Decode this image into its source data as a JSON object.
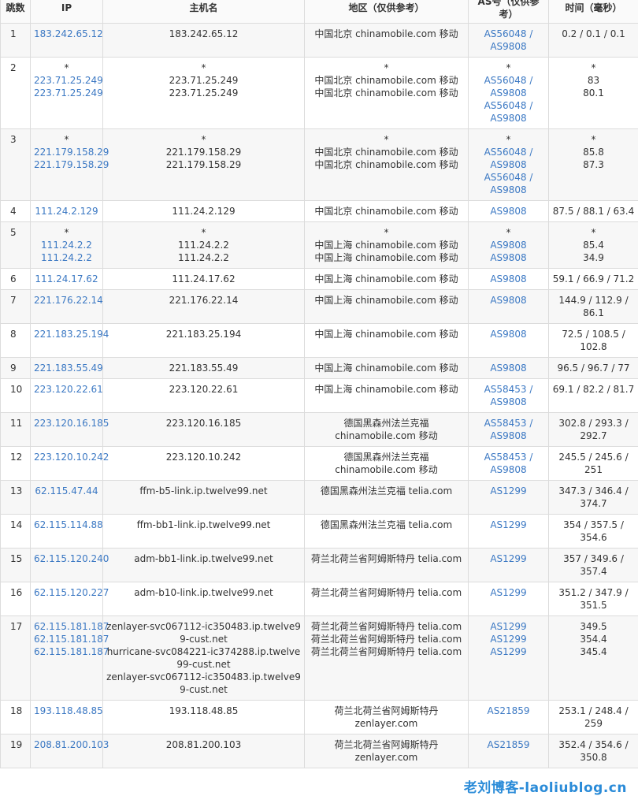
{
  "headers": {
    "hop": "跳数",
    "ip": "IP",
    "host": "主机名",
    "region": "地区（仅供参考）",
    "as": "AS号（仅供参考）",
    "time": "时间（毫秒）"
  },
  "rows": [
    {
      "hop": "1",
      "ip": [
        "183.242.65.12"
      ],
      "host": [
        "183.242.65.12"
      ],
      "region": [
        "中国北京 chinamobile.com 移动"
      ],
      "as": [
        "AS56048 / AS9808"
      ],
      "time": [
        "0.2 / 0.1 / 0.1"
      ]
    },
    {
      "hop": "2",
      "ip": [
        "*",
        "223.71.25.249",
        "223.71.25.249"
      ],
      "host": [
        "*",
        "223.71.25.249",
        "223.71.25.249"
      ],
      "region": [
        "*",
        "中国北京 chinamobile.com 移动",
        "中国北京 chinamobile.com 移动"
      ],
      "as": [
        "*",
        "AS56048 / AS9808",
        "AS56048 / AS9808"
      ],
      "time": [
        "*",
        "83",
        "80.1"
      ]
    },
    {
      "hop": "3",
      "ip": [
        "*",
        "221.179.158.29",
        "221.179.158.29"
      ],
      "host": [
        "*",
        "221.179.158.29",
        "221.179.158.29"
      ],
      "region": [
        "*",
        "中国北京 chinamobile.com 移动",
        "中国北京 chinamobile.com 移动"
      ],
      "as": [
        "*",
        "AS56048 / AS9808",
        "AS56048 / AS9808"
      ],
      "time": [
        "*",
        "85.8",
        "87.3"
      ]
    },
    {
      "hop": "4",
      "ip": [
        "111.24.2.129"
      ],
      "host": [
        "111.24.2.129"
      ],
      "region": [
        "中国北京 chinamobile.com 移动"
      ],
      "as": [
        "AS9808"
      ],
      "time": [
        "87.5 / 88.1 / 63.4"
      ]
    },
    {
      "hop": "5",
      "ip": [
        "*",
        "111.24.2.2",
        "111.24.2.2"
      ],
      "host": [
        "*",
        "111.24.2.2",
        "111.24.2.2"
      ],
      "region": [
        "*",
        "中国上海 chinamobile.com 移动",
        "中国上海 chinamobile.com 移动"
      ],
      "as": [
        "*",
        "AS9808",
        "AS9808"
      ],
      "time": [
        "*",
        "85.4",
        "34.9"
      ]
    },
    {
      "hop": "6",
      "ip": [
        "111.24.17.62"
      ],
      "host": [
        "111.24.17.62"
      ],
      "region": [
        "中国上海 chinamobile.com 移动"
      ],
      "as": [
        "AS9808"
      ],
      "time": [
        "59.1 / 66.9 / 71.2"
      ]
    },
    {
      "hop": "7",
      "ip": [
        "221.176.22.14"
      ],
      "host": [
        "221.176.22.14"
      ],
      "region": [
        "中国上海 chinamobile.com 移动"
      ],
      "as": [
        "AS9808"
      ],
      "time": [
        "144.9 / 112.9 / 86.1"
      ]
    },
    {
      "hop": "8",
      "ip": [
        "221.183.25.194"
      ],
      "host": [
        "221.183.25.194"
      ],
      "region": [
        "中国上海 chinamobile.com 移动"
      ],
      "as": [
        "AS9808"
      ],
      "time": [
        "72.5 / 108.5 / 102.8"
      ]
    },
    {
      "hop": "9",
      "ip": [
        "221.183.55.49"
      ],
      "host": [
        "221.183.55.49"
      ],
      "region": [
        "中国上海 chinamobile.com 移动"
      ],
      "as": [
        "AS9808"
      ],
      "time": [
        "96.5 / 96.7 / 77"
      ]
    },
    {
      "hop": "10",
      "ip": [
        "223.120.22.61"
      ],
      "host": [
        "223.120.22.61"
      ],
      "region": [
        "中国上海 chinamobile.com 移动"
      ],
      "as": [
        "AS58453 / AS9808"
      ],
      "time": [
        "69.1 / 82.2 / 81.7"
      ]
    },
    {
      "hop": "11",
      "ip": [
        "223.120.16.185"
      ],
      "host": [
        "223.120.16.185"
      ],
      "region": [
        "德国黑森州法兰克福 chinamobile.com 移动"
      ],
      "as": [
        "AS58453 / AS9808"
      ],
      "time": [
        "302.8 / 293.3 / 292.7"
      ]
    },
    {
      "hop": "12",
      "ip": [
        "223.120.10.242"
      ],
      "host": [
        "223.120.10.242"
      ],
      "region": [
        "德国黑森州法兰克福 chinamobile.com 移动"
      ],
      "as": [
        "AS58453 / AS9808"
      ],
      "time": [
        "245.5 / 245.6 / 251"
      ]
    },
    {
      "hop": "13",
      "ip": [
        "62.115.47.44"
      ],
      "host": [
        "ffm-b5-link.ip.twelve99.net"
      ],
      "region": [
        "德国黑森州法兰克福 telia.com"
      ],
      "as": [
        "AS1299"
      ],
      "time": [
        "347.3 / 346.4 / 374.7"
      ]
    },
    {
      "hop": "14",
      "ip": [
        "62.115.114.88"
      ],
      "host": [
        "ffm-bb1-link.ip.twelve99.net"
      ],
      "region": [
        "德国黑森州法兰克福 telia.com"
      ],
      "as": [
        "AS1299"
      ],
      "time": [
        "354 / 357.5 / 354.6"
      ]
    },
    {
      "hop": "15",
      "ip": [
        "62.115.120.240"
      ],
      "host": [
        "adm-bb1-link.ip.twelve99.net"
      ],
      "region": [
        "荷兰北荷兰省阿姆斯特丹 telia.com"
      ],
      "as": [
        "AS1299"
      ],
      "time": [
        "357 / 349.6 / 357.4"
      ]
    },
    {
      "hop": "16",
      "ip": [
        "62.115.120.227"
      ],
      "host": [
        "adm-b10-link.ip.twelve99.net"
      ],
      "region": [
        "荷兰北荷兰省阿姆斯特丹 telia.com"
      ],
      "as": [
        "AS1299"
      ],
      "time": [
        "351.2 / 347.9 / 351.5"
      ]
    },
    {
      "hop": "17",
      "ip": [
        "62.115.181.187",
        "62.115.181.187",
        "62.115.181.187"
      ],
      "host": [
        "zenlayer-svc067112-ic350483.ip.twelve99-cust.net",
        "hurricane-svc084221-ic374288.ip.twelve99-cust.net",
        "zenlayer-svc067112-ic350483.ip.twelve99-cust.net"
      ],
      "region": [
        "荷兰北荷兰省阿姆斯特丹 telia.com",
        "荷兰北荷兰省阿姆斯特丹 telia.com",
        "荷兰北荷兰省阿姆斯特丹 telia.com"
      ],
      "as": [
        "AS1299",
        "AS1299",
        "AS1299"
      ],
      "time": [
        "349.5",
        "354.4",
        "345.4"
      ]
    },
    {
      "hop": "18",
      "ip": [
        "193.118.48.85"
      ],
      "host": [
        "193.118.48.85"
      ],
      "region": [
        "荷兰北荷兰省阿姆斯特丹 zenlayer.com"
      ],
      "as": [
        "AS21859"
      ],
      "time": [
        "253.1 / 248.4 / 259"
      ]
    },
    {
      "hop": "19",
      "ip": [
        "208.81.200.103"
      ],
      "host": [
        "208.81.200.103"
      ],
      "region": [
        "荷兰北荷兰省阿姆斯特丹 zenlayer.com"
      ],
      "as": [
        "AS21859"
      ],
      "time": [
        "352.4 / 354.6 / 350.8"
      ]
    }
  ],
  "watermark": "老刘博客-laoliublog.cn",
  "colors": {
    "link": "#3b78c3",
    "stripe": "#f7f7f7",
    "border": "#dcdcdc",
    "watermark": "#2a8bd8"
  }
}
